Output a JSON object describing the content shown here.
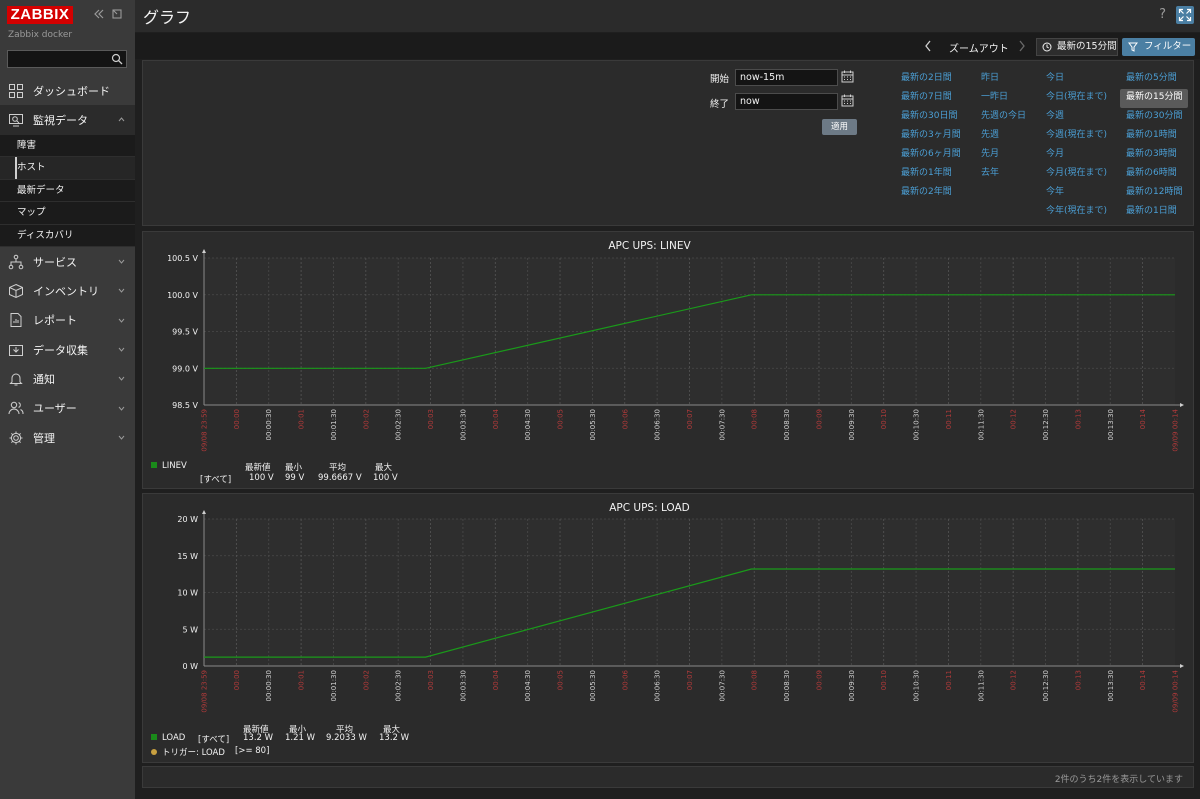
{
  "app": {
    "logo": "ZABBIX",
    "server_name": "Zabbix docker",
    "page_title": "グラフ",
    "help": "?"
  },
  "sidebar": {
    "items": [
      {
        "label": "ダッシュボード",
        "icon": "dashboard-icon",
        "expandable": false
      },
      {
        "label": "監視データ",
        "icon": "monitoring-icon",
        "expandable": true,
        "expanded": true,
        "submenu": [
          {
            "label": "障害",
            "selected": false
          },
          {
            "label": "ホスト",
            "selected": true
          },
          {
            "label": "最新データ",
            "selected": false
          },
          {
            "label": "マップ",
            "selected": false
          },
          {
            "label": "ディスカバリ",
            "selected": false
          }
        ]
      },
      {
        "label": "サービス",
        "icon": "services-icon",
        "expandable": true
      },
      {
        "label": "インベントリ",
        "icon": "inventory-icon",
        "expandable": true
      },
      {
        "label": "レポート",
        "icon": "reports-icon",
        "expandable": true
      },
      {
        "label": "データ収集",
        "icon": "data-collection-icon",
        "expandable": true
      },
      {
        "label": "通知",
        "icon": "alerts-icon",
        "expandable": true
      },
      {
        "label": "ユーザー",
        "icon": "users-icon",
        "expandable": true
      },
      {
        "label": "管理",
        "icon": "administration-icon",
        "expandable": true
      }
    ]
  },
  "timebar": {
    "zoom_out": "ズームアウト",
    "time_tab": "最新の15分間",
    "filter_tab": "フィルター"
  },
  "filter": {
    "from_label": "開始",
    "from_value": "now-15m",
    "to_label": "終了",
    "to_value": "now",
    "apply": "適用",
    "quick_ranges": [
      [
        "最新の2日間",
        "最新の7日間",
        "最新の30日間",
        "最新の3ヶ月間",
        "最新の6ヶ月間",
        "最新の1年間",
        "最新の2年間"
      ],
      [
        "昨日",
        "一昨日",
        "先週の今日",
        "先週",
        "先月",
        "去年"
      ],
      [
        "今日",
        "今日(現在まで)",
        "今週",
        "今週(現在まで)",
        "今月",
        "今月(現在まで)",
        "今年",
        "今年(現在まで)"
      ],
      [
        "最新の5分間",
        "最新の15分間",
        "最新の30分間",
        "最新の1時間",
        "最新の3時間",
        "最新の6時間",
        "最新の12時間",
        "最新の1日間"
      ]
    ],
    "quick_selected": "最新の15分間"
  },
  "graphs": [
    {
      "legend_item": "LINEV",
      "legend_func": "[すべて]",
      "legend_headers": [
        "最新値",
        "最小",
        "平均",
        "最大"
      ],
      "legend_values": [
        "100 V",
        "99 V",
        "99.6667 V",
        "100 V"
      ]
    },
    {
      "legend_item": "LOAD",
      "legend_func": "[すべて]",
      "legend_headers": [
        "最新値",
        "最小",
        "平均",
        "最大"
      ],
      "legend_values": [
        "13.2 W",
        "1.21 W",
        "9.2033 W",
        "13.2 W"
      ],
      "trigger_label": "トリガー: LOAD",
      "trigger_value": "[>= 80]"
    }
  ],
  "chart_data": [
    {
      "type": "line",
      "title": "APC UPS: LINEV",
      "y_ticks": [
        "98.5 V",
        "99.0 V",
        "99.5 V",
        "100.0 V",
        "100.5 V"
      ],
      "ylim": [
        98.5,
        100.5
      ],
      "x_ticks": [
        "09/08 23:59",
        "00:00",
        "00:00:30",
        "00:01",
        "00:01:30",
        "00:02",
        "00:02:30",
        "00:03",
        "00:03:30",
        "00:04",
        "00:04:30",
        "00:05",
        "00:05:30",
        "00:06",
        "00:06:30",
        "00:07",
        "00:07:30",
        "00:08",
        "00:08:30",
        "00:09",
        "00:09:30",
        "00:10",
        "00:10:30",
        "00:11",
        "00:11:30",
        "00:12",
        "00:12:30",
        "00:13",
        "00:13:30",
        "00:14",
        "09/09 00:14"
      ],
      "x_tick_red": [
        true,
        true,
        false,
        true,
        false,
        true,
        false,
        true,
        false,
        true,
        false,
        true,
        false,
        true,
        false,
        true,
        false,
        true,
        false,
        true,
        false,
        true,
        false,
        true,
        false,
        true,
        false,
        true,
        false,
        true,
        true
      ],
      "series": [
        {
          "name": "LINEV",
          "color": "#1a9a1a",
          "points": [
            [
              -0.6,
              99.0
            ],
            [
              2.8,
              99.0
            ],
            [
              7.8,
              100.0
            ],
            [
              14.3,
              100.0
            ]
          ]
        }
      ],
      "x_range_minutes": [
        -0.6,
        14.3
      ]
    },
    {
      "type": "line",
      "title": "APC UPS: LOAD",
      "y_ticks": [
        "0 W",
        "5 W",
        "10 W",
        "15 W",
        "20 W"
      ],
      "ylim": [
        0,
        20
      ],
      "x_ticks": [
        "09/08 23:59",
        "00:00",
        "00:00:30",
        "00:01",
        "00:01:30",
        "00:02",
        "00:02:30",
        "00:03",
        "00:03:30",
        "00:04",
        "00:04:30",
        "00:05",
        "00:05:30",
        "00:06",
        "00:06:30",
        "00:07",
        "00:07:30",
        "00:08",
        "00:08:30",
        "00:09",
        "00:09:30",
        "00:10",
        "00:10:30",
        "00:11",
        "00:11:30",
        "00:12",
        "00:12:30",
        "00:13",
        "00:13:30",
        "00:14",
        "09/09 00:14"
      ],
      "x_tick_red": [
        true,
        true,
        false,
        true,
        false,
        true,
        false,
        true,
        false,
        true,
        false,
        true,
        false,
        true,
        false,
        true,
        false,
        true,
        false,
        true,
        false,
        true,
        false,
        true,
        false,
        true,
        false,
        true,
        false,
        true,
        true
      ],
      "series": [
        {
          "name": "LOAD",
          "color": "#1a9a1a",
          "points": [
            [
              -0.6,
              1.21
            ],
            [
              2.8,
              1.21
            ],
            [
              7.8,
              13.2
            ],
            [
              14.3,
              13.2
            ]
          ]
        }
      ],
      "x_range_minutes": [
        -0.6,
        14.3
      ]
    }
  ],
  "footer": {
    "paging": "2件のうち2件を表示しています"
  },
  "colors": {
    "accent": "#4b7fa3",
    "link": "#4b9fd5",
    "logo_red": "#d40000",
    "series_green": "#1a9a1a",
    "tick_red": "#b03a3a"
  }
}
